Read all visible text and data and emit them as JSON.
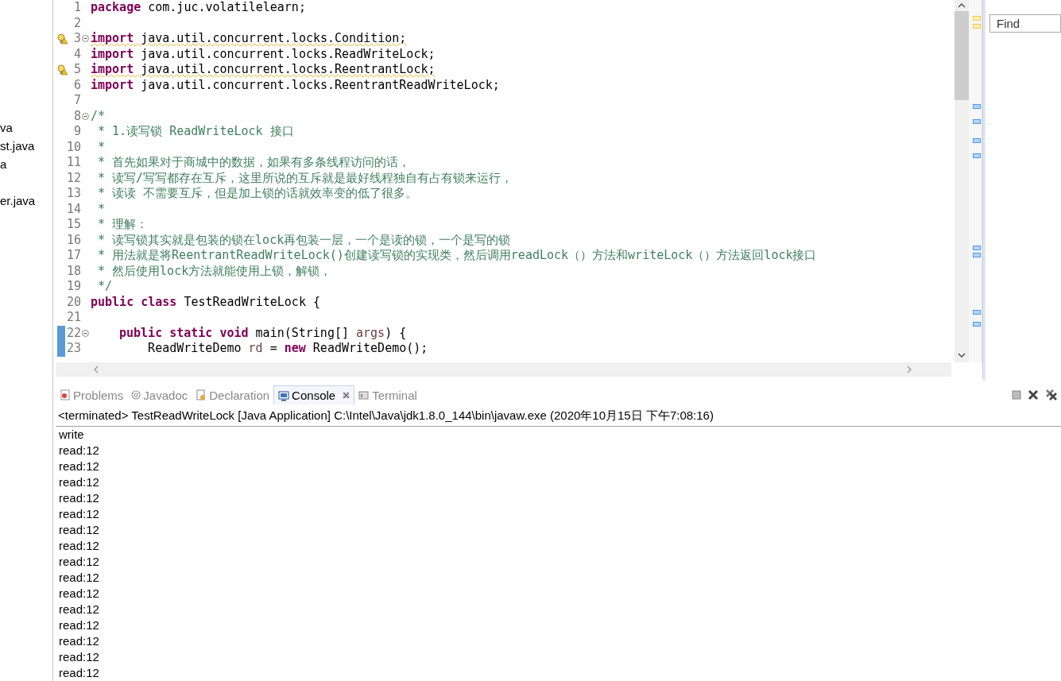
{
  "explorer": {
    "items": [
      "va",
      "st.java",
      "a",
      "er.java"
    ]
  },
  "editor": {
    "lines": [
      {
        "num": "1",
        "warning": false,
        "fold": false,
        "changed": false,
        "segments": [
          {
            "kind": "keyword",
            "text": "package"
          },
          {
            "kind": "plain",
            "text": " com.juc.volatilelearn;"
          }
        ]
      },
      {
        "num": "2",
        "warning": false,
        "fold": false,
        "changed": false
      },
      {
        "num": "3",
        "warning": true,
        "fold": true,
        "changed": false,
        "segments": [
          {
            "kind": "keyword",
            "text": "import"
          },
          {
            "kind": "plain",
            "text": " java.util.concurrent.locks.Condition;"
          }
        ]
      },
      {
        "num": "4",
        "warning": false,
        "fold": false,
        "changed": false,
        "segments": [
          {
            "kind": "keyword",
            "text": "import"
          },
          {
            "kind": "plain",
            "text": " java.util.concurrent.locks.ReadWriteLock;"
          }
        ]
      },
      {
        "num": "5",
        "warning": true,
        "fold": false,
        "changed": false,
        "segments": [
          {
            "kind": "keyword",
            "text": "import"
          },
          {
            "kind": "plain",
            "text": " java.util.concurrent.locks.ReentrantLock;"
          }
        ]
      },
      {
        "num": "6",
        "warning": false,
        "fold": false,
        "changed": false,
        "segments": [
          {
            "kind": "keyword",
            "text": "import"
          },
          {
            "kind": "plain",
            "text": " java.util.concurrent.locks.ReentrantReadWriteLock;"
          }
        ]
      },
      {
        "num": "7",
        "warning": false,
        "fold": false,
        "changed": false
      },
      {
        "num": "8",
        "warning": false,
        "fold": true,
        "changed": false,
        "segments": [
          {
            "kind": "comment",
            "text": "/*"
          }
        ]
      },
      {
        "num": "9",
        "warning": false,
        "fold": false,
        "changed": false,
        "segments": [
          {
            "kind": "comment",
            "text": " * 1.读写锁 ReadWriteLock 接口"
          }
        ]
      },
      {
        "num": "10",
        "warning": false,
        "fold": false,
        "changed": false,
        "segments": [
          {
            "kind": "comment",
            "text": " *"
          }
        ]
      },
      {
        "num": "11",
        "warning": false,
        "fold": false,
        "changed": false,
        "segments": [
          {
            "kind": "comment",
            "text": " * 首先如果对于商城中的数据，如果有多条线程访问的话，"
          }
        ]
      },
      {
        "num": "12",
        "warning": false,
        "fold": false,
        "changed": false,
        "segments": [
          {
            "kind": "comment",
            "text": " * 读写/写写都存在互斥，这里所说的互斥就是最好线程独自有占有锁来运行，"
          }
        ]
      },
      {
        "num": "13",
        "warning": false,
        "fold": false,
        "changed": false,
        "segments": [
          {
            "kind": "comment",
            "text": " * 读读 不需要互斥，但是加上锁的话就效率变的低了很多。"
          }
        ]
      },
      {
        "num": "14",
        "warning": false,
        "fold": false,
        "changed": false,
        "segments": [
          {
            "kind": "comment",
            "text": " *"
          }
        ]
      },
      {
        "num": "15",
        "warning": false,
        "fold": false,
        "changed": false,
        "segments": [
          {
            "kind": "comment",
            "text": " * 理解："
          }
        ]
      },
      {
        "num": "16",
        "warning": false,
        "fold": false,
        "changed": false,
        "segments": [
          {
            "kind": "comment",
            "text": " * 读写锁其实就是包装的锁在lock再包装一层，一个是读的锁，一个是写的锁"
          }
        ]
      },
      {
        "num": "17",
        "warning": false,
        "fold": false,
        "changed": false,
        "segments": [
          {
            "kind": "comment",
            "text": " * 用法就是将ReentrantReadWriteLock()创建读写锁的实现类，然后调用readLock（）方法和writeLock（）方法返回lock接口"
          }
        ]
      },
      {
        "num": "18",
        "warning": false,
        "fold": false,
        "changed": false,
        "segments": [
          {
            "kind": "comment",
            "text": " * 然后使用lock方法就能使用上锁，解锁，"
          }
        ]
      },
      {
        "num": "19",
        "warning": false,
        "fold": false,
        "changed": false,
        "segments": [
          {
            "kind": "comment",
            "text": " */"
          }
        ]
      },
      {
        "num": "20",
        "warning": false,
        "fold": false,
        "changed": false,
        "segments": [
          {
            "kind": "keyword",
            "text": "public class"
          },
          {
            "kind": "plain",
            "text": " TestReadWriteLock {"
          }
        ]
      },
      {
        "num": "21",
        "warning": false,
        "fold": false,
        "changed": false
      },
      {
        "num": "22",
        "warning": false,
        "fold": true,
        "changed": true,
        "segments": [
          {
            "kind": "keyword",
            "text": "public static void"
          },
          {
            "kind": "plain",
            "text": " main(String[] "
          },
          {
            "kind": "param",
            "text": "args"
          },
          {
            "kind": "plain",
            "text": ") {"
          }
        ]
      },
      {
        "num": "23",
        "warning": false,
        "fold": false,
        "changed": true,
        "segments": [
          {
            "kind": "plain",
            "text": "    ReadWriteDemo "
          },
          {
            "kind": "param",
            "text": "rd"
          },
          {
            "kind": "plain",
            "text": " = "
          },
          {
            "kind": "keyword",
            "text": "new"
          },
          {
            "kind": "plain",
            "text": " ReadWriteDemo();"
          }
        ]
      }
    ]
  },
  "find": {
    "placeholder": "Find"
  },
  "console": {
    "tabs": [
      {
        "label": "Problems",
        "selected": false
      },
      {
        "label": "Javadoc",
        "selected": false
      },
      {
        "label": "Declaration",
        "selected": false
      },
      {
        "label": "Console",
        "selected": true
      },
      {
        "label": "Terminal",
        "selected": false
      }
    ],
    "status": "<terminated> TestReadWriteLock [Java Application] C:\\Intel\\Java\\jdk1.8.0_144\\bin\\javaw.exe (2020年10月15日 下午7:08:16)",
    "output": [
      "write",
      "read:12",
      "read:12",
      "read:12",
      "read:12",
      "read:12",
      "read:12",
      "read:12",
      "read:12",
      "read:12",
      "read:12",
      "read:12",
      "read:12",
      "read:12",
      "read:12",
      "read:12"
    ]
  }
}
